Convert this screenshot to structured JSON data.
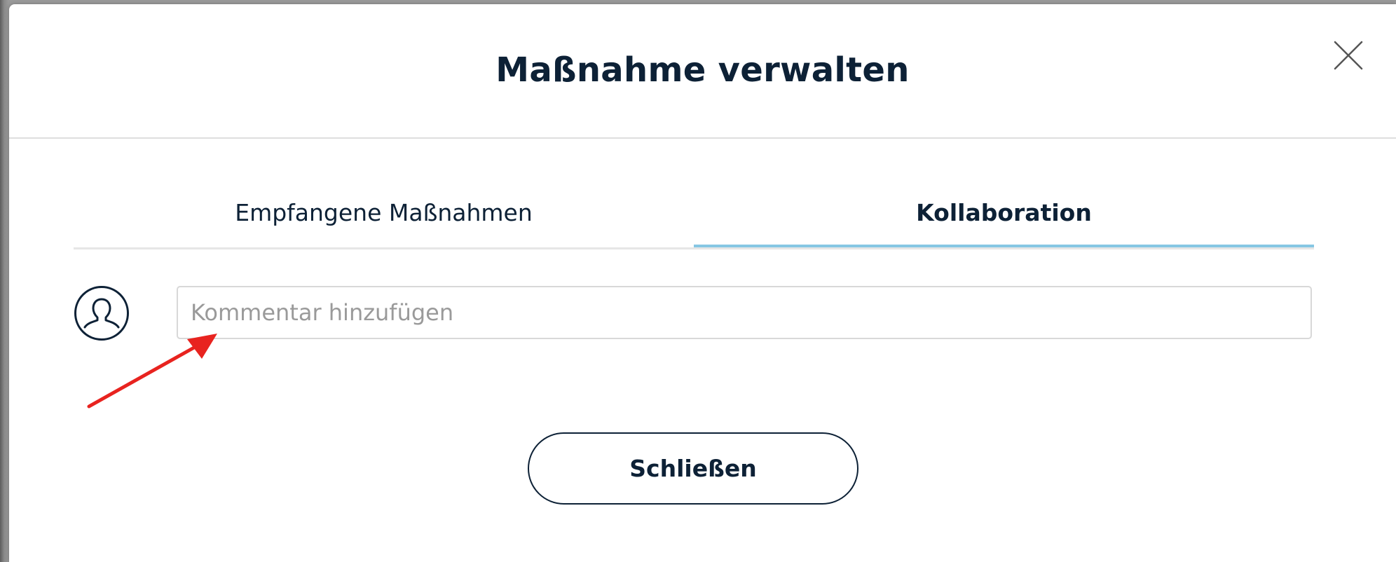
{
  "dialog": {
    "title": "Maßnahme verwalten",
    "close_icon": "close-icon"
  },
  "tabs": [
    {
      "label": "Empfangene Maßnahmen",
      "active": false
    },
    {
      "label": "Kollaboration",
      "active": true
    }
  ],
  "comment": {
    "avatar_icon": "user-avatar-icon",
    "placeholder": "Kommentar hinzufügen",
    "value": ""
  },
  "footer": {
    "close_label": "Schließen"
  },
  "annotation": {
    "arrow_icon": "red-arrow-annotation",
    "color": "#e8231f"
  },
  "colors": {
    "text_dark": "#0d2136",
    "tab_active_indicator": "#86c7e3",
    "divider": "#dedede"
  }
}
